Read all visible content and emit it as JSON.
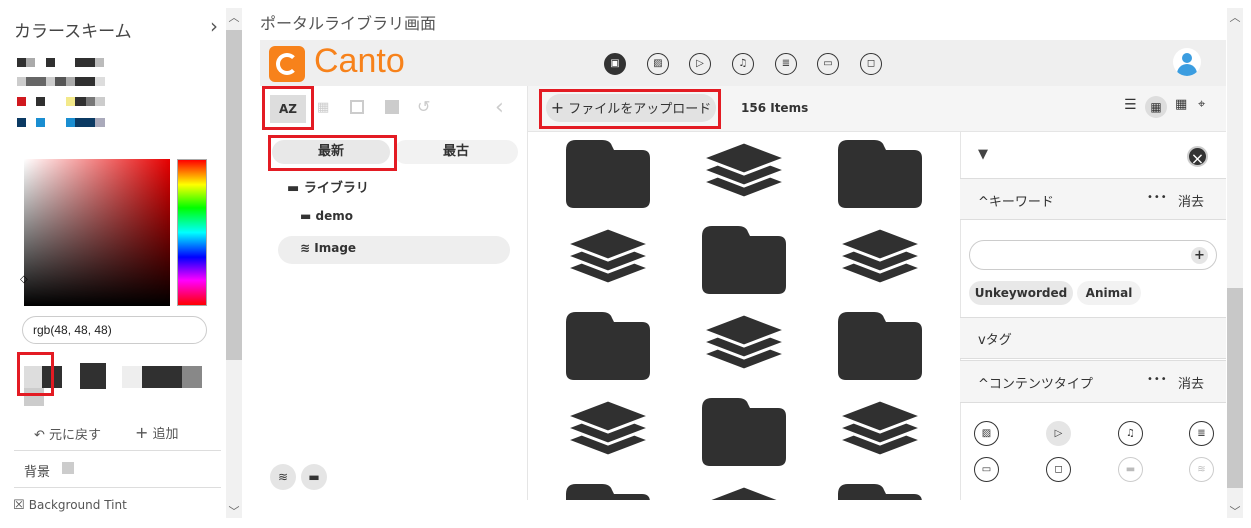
{
  "left_panel": {
    "title": "カラースキーム",
    "expand_glyph": "›",
    "rgb_value": "rgb(48, 48, 48)",
    "undo_label": "元に戻す",
    "undo_glyph": "↶",
    "add_label": "追加",
    "add_glyph": "+",
    "bg_label": "背景",
    "tint_label": "Background Tint",
    "tint_glyph": "☒",
    "swatch_colors": {
      "red": "#d0191f",
      "yellow": "#f3e98a",
      "blue": "#1a8ed1",
      "navy": "#0b3a63",
      "dark": "#303030",
      "mid": "#777777",
      "light": "#cccccc"
    }
  },
  "page_title": "ポータルライブラリ画面",
  "brand": {
    "name": "Canto",
    "color": "#f7821b"
  },
  "topnav_icons": [
    "all-icon",
    "image-icon",
    "video-icon",
    "audio-icon",
    "document-icon",
    "presentation-icon",
    "other-icon"
  ],
  "tree": {
    "sort_az": "AZ",
    "tab_newest": "最新",
    "tab_oldest": "最古",
    "root_label": "ライブラリ",
    "child_demo": "demo",
    "child_image": "Image"
  },
  "toolbar": {
    "upload_label": "ファイルをアップロード",
    "upload_glyph": "+",
    "item_count": "156 Items"
  },
  "grid_items": [
    "folder",
    "stack",
    "folder",
    "stack",
    "folder",
    "stack",
    "folder",
    "stack",
    "folder",
    "stack",
    "folder",
    "stack"
  ],
  "filter": {
    "keyword_header": "キーワード",
    "keyword_clear": "消去",
    "more_glyph": "•••",
    "chip_1": "Unkeyworded",
    "chip_2": "Animal",
    "tag_header": "タグ",
    "content_header": "コンテンツタイプ",
    "content_clear": "消去",
    "close_glyph": "×",
    "add_glyph": "+"
  }
}
